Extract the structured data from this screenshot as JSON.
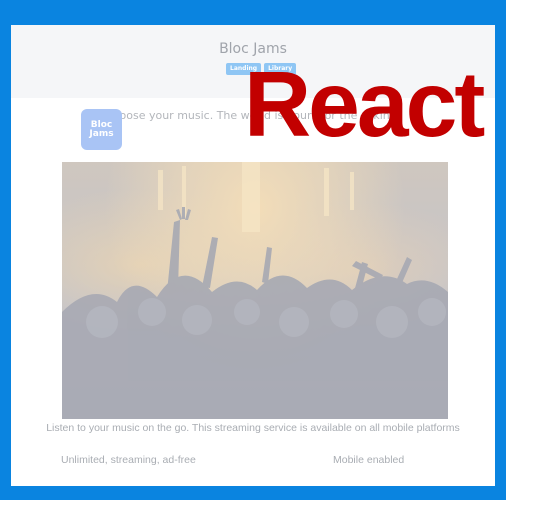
{
  "header": {
    "title": "Bloc Jams",
    "nav": [
      {
        "label": "Landing"
      },
      {
        "label": "Library"
      }
    ]
  },
  "logo": {
    "line1": "Bloc",
    "line2": "Jams"
  },
  "tagline": "Choose your music. The world is yours for the asking!",
  "hero": {
    "alt": "concert crowd image"
  },
  "description": "Listen to your music on the go. This streaming service is available on all mobile platforms",
  "features": [
    {
      "label": "Unlimited, streaming, ad-free"
    },
    {
      "label": "Mobile enabled"
    }
  ],
  "overlay": {
    "text": "React"
  },
  "colors": {
    "frame": "#0a84e0",
    "overlay_text": "#c20000",
    "nav_button": "#8fc6f4",
    "logo_bg": "#a9c4f5"
  }
}
